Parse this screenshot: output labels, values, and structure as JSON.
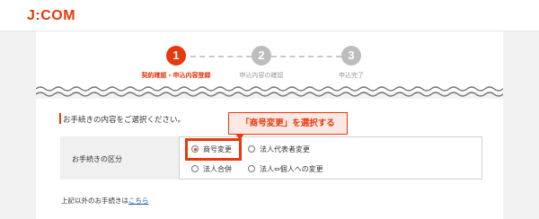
{
  "header": {
    "logo": "J:COM"
  },
  "steps": [
    {
      "number": "1",
      "label": "契約確認・申込内容登録",
      "active": true
    },
    {
      "number": "2",
      "label": "申込内容の確認",
      "active": false
    },
    {
      "number": "3",
      "label": "申込完了",
      "active": false
    }
  ],
  "colors": {
    "accent": "#e8380d",
    "inactive": "#bdbdbd",
    "link": "#1a57b3"
  },
  "form": {
    "section_title": "お手続きの内容をご選択ください。",
    "row_label": "お手続きの区分",
    "options": [
      {
        "label": "商号変更",
        "checked": true
      },
      {
        "label": "法人代表者変更",
        "checked": false
      },
      {
        "label": "法人合併",
        "checked": false
      },
      {
        "label": "法人⇔個人への変更",
        "checked": false
      }
    ]
  },
  "callout": "「商号変更」を選択する",
  "footer": {
    "text": "上記以外のお手続きは",
    "link": "こちら"
  }
}
